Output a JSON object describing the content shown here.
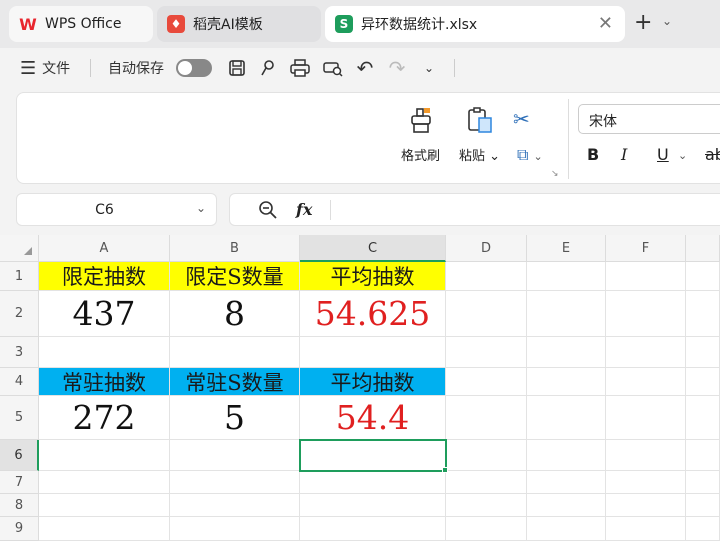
{
  "tabs": [
    {
      "label": "WPS Office",
      "icon": "wps-logo-icon",
      "logo_text": "W"
    },
    {
      "label": "稻壳AI模板",
      "icon": "daoke-logo-icon",
      "logo_text": "♦"
    },
    {
      "label": "异环数据统计.xlsx",
      "icon": "sheet-logo-icon",
      "logo_text": "S",
      "active": true
    }
  ],
  "quickbar": {
    "menu_label": "文件",
    "autosave_label": "自动保存",
    "autosave_on": false
  },
  "ribbon": {
    "format_painter": "格式刷",
    "paste": "粘贴",
    "cut_icon": "scissors-icon",
    "font_name": "宋体",
    "bold": "B",
    "italic": "I",
    "underline": "U",
    "strike": "ab"
  },
  "formula_bar": {
    "cell_ref": "C6",
    "fx": "fx",
    "content": ""
  },
  "columns": [
    "A",
    "B",
    "C",
    "D",
    "E",
    "F"
  ],
  "rows": [
    "1",
    "2",
    "3",
    "4",
    "5",
    "6",
    "7",
    "8",
    "9"
  ],
  "cells": {
    "A1": "限定抽数",
    "B1": "限定S数量",
    "C1": "平均抽数",
    "A2": "437",
    "B2": "8",
    "C2": "54.625",
    "A4": "常驻抽数",
    "B4": "常驻S数量",
    "C4": "平均抽数",
    "A5": "272",
    "B5": "5",
    "C5": "54.4"
  },
  "colors": {
    "row1_fill": "#ffff00",
    "row4_fill": "#00b0f0",
    "result_text": "#e02020",
    "accent": "#1e9d5c"
  },
  "selected_cell": "C6"
}
